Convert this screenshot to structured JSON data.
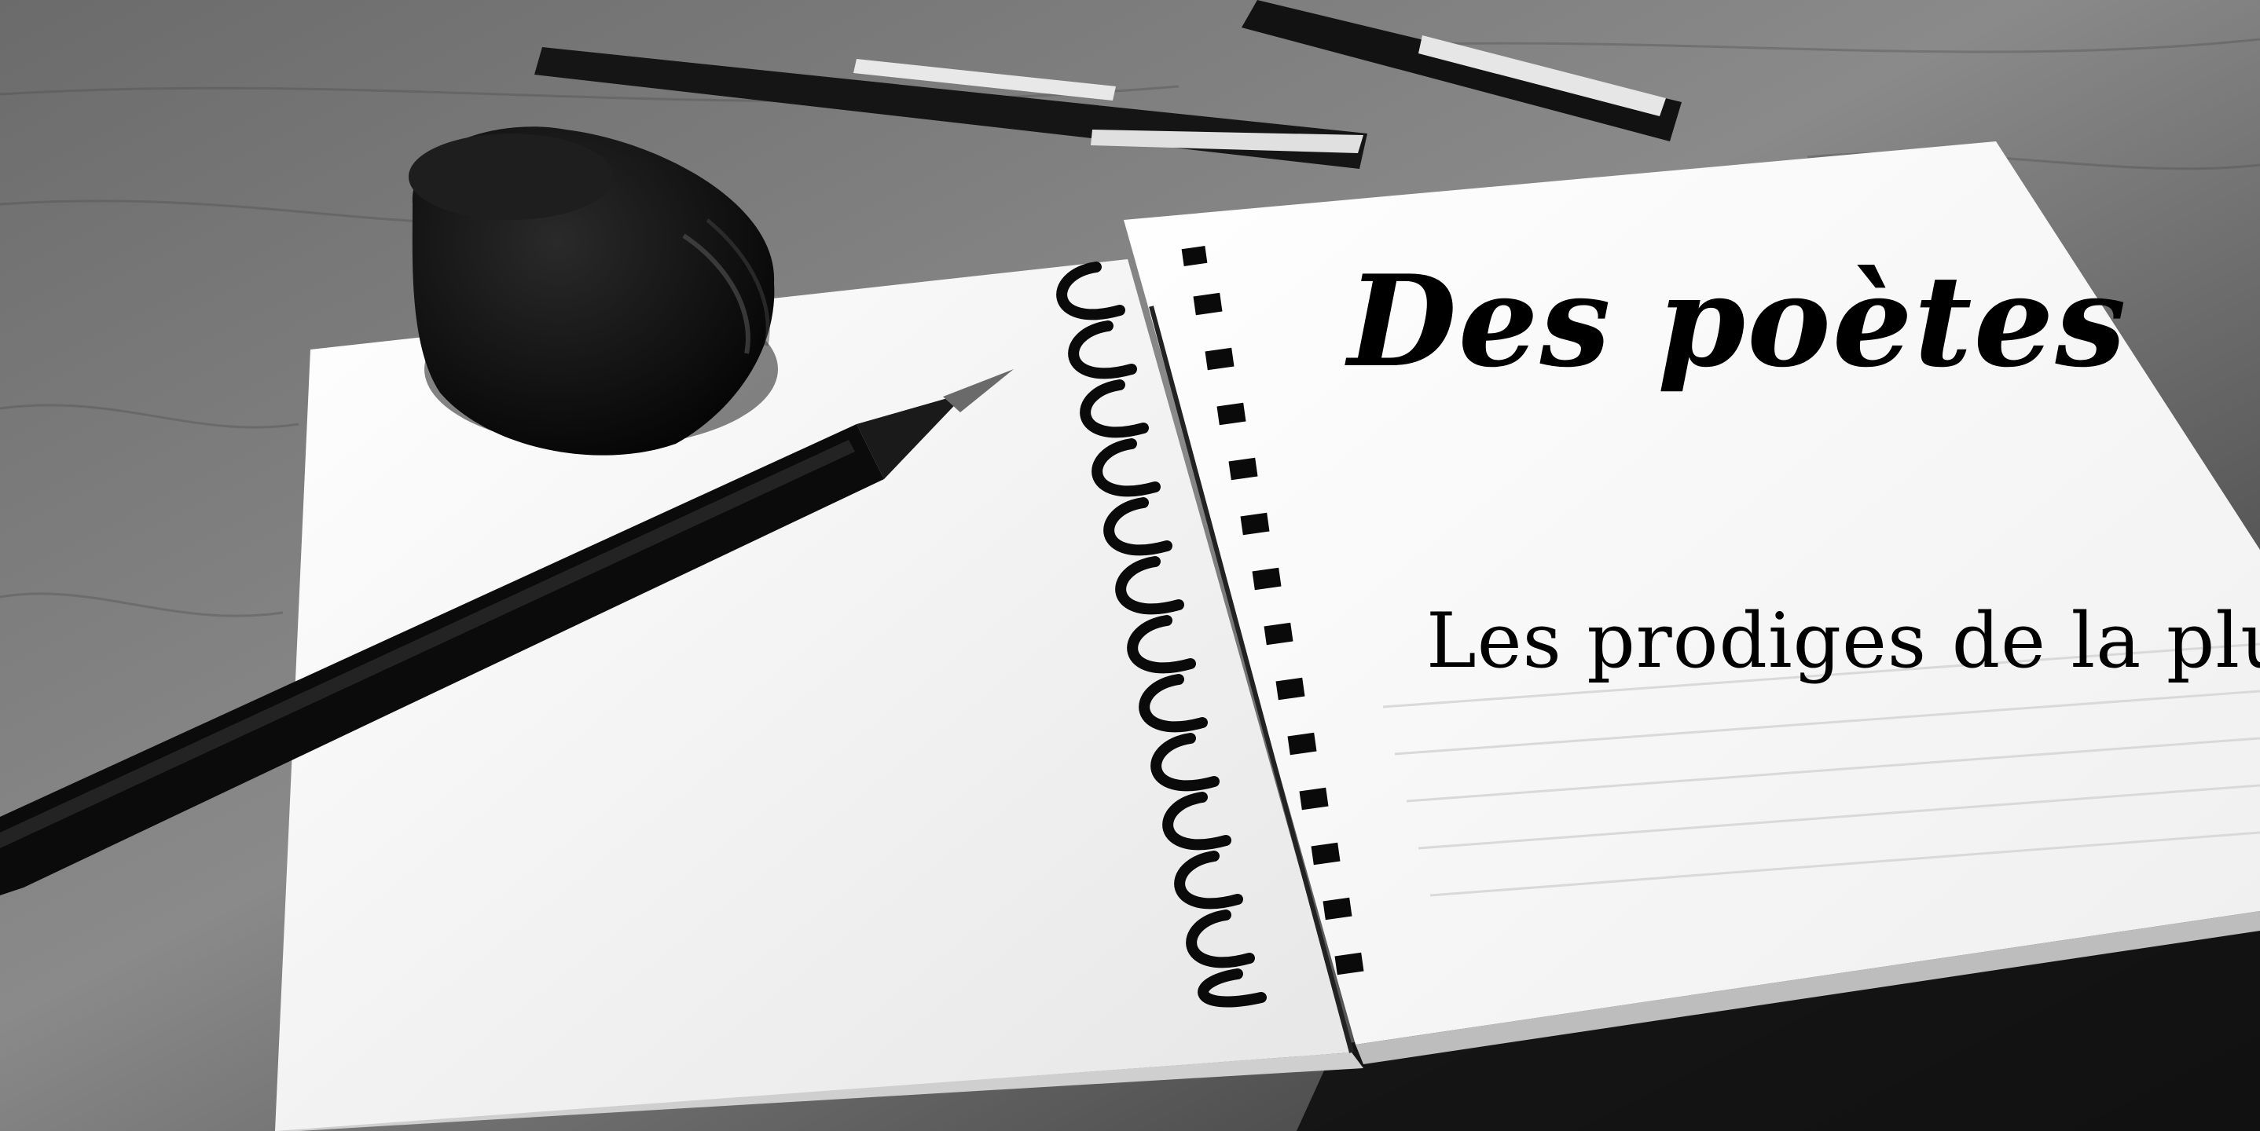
{
  "banner": {
    "title": "Des poètes",
    "subtitle": "Les prodiges de la plume"
  },
  "colors": {
    "desk": "#5a5a5a",
    "paper": "#f7f7f7",
    "ink": "#0a0a0a",
    "text": "#000000"
  },
  "objects": [
    "wooden-desk",
    "spiral-notebook",
    "ink-bottle",
    "fountain-pen",
    "pens"
  ]
}
